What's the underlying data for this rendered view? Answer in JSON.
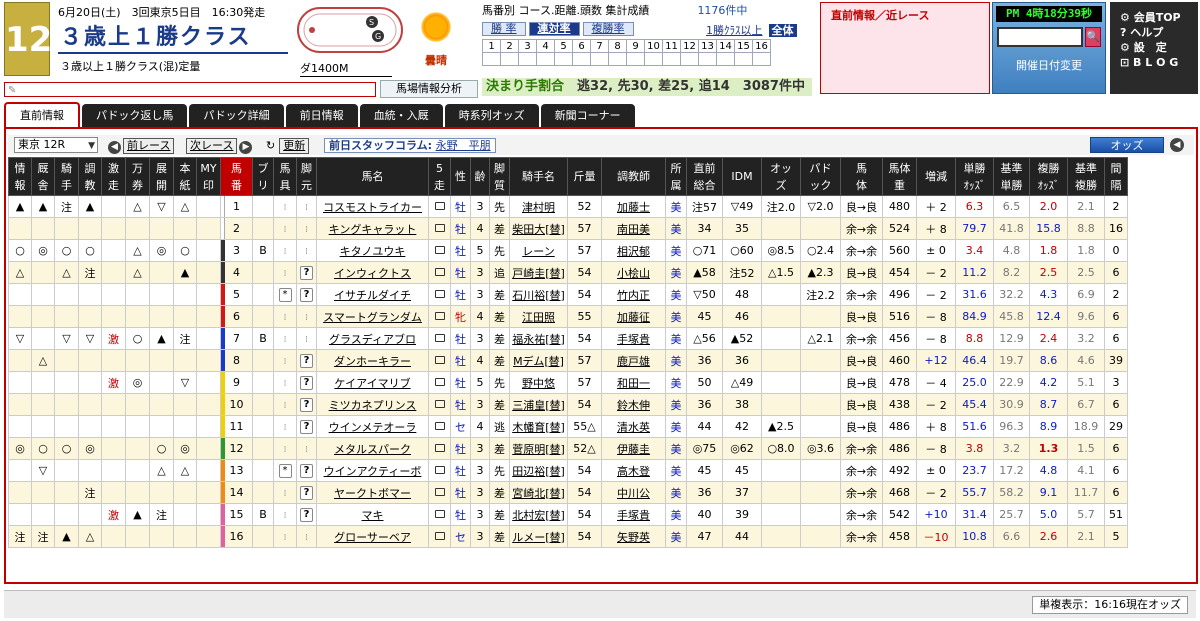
{
  "race": {
    "number": "12",
    "date_line": "6月20日(土)　3回東京5日目　16:30発走",
    "title": "３歳上１勝クラス",
    "subtitle": "３歳以上１勝クラス(混)定量",
    "distance": "ダ1400M",
    "weather": "曇晴"
  },
  "memo_placeholder": "✎",
  "babashi_button": "馬場情報分析",
  "stats": {
    "header": "馬番別 コース.距離.頭数 集計成績",
    "count": "1176件中",
    "tabs": [
      "勝 率",
      "連対率",
      "複勝率"
    ],
    "tabs_selected": "連対率",
    "class_link": "1勝ｸﾗｽ以上",
    "all_label": "全体",
    "grid_row1": [
      "1",
      "2",
      "3",
      "4",
      "5",
      "6",
      "7",
      "8",
      "9",
      "10",
      "11",
      "12",
      "13",
      "14",
      "15",
      "16"
    ],
    "grid_row2": [
      "",
      "",
      "",
      "",
      "",
      "",
      "",
      "",
      "",
      "",
      "",
      "",
      "",
      "",
      "",
      ""
    ],
    "kimari_label": "決まり手割合",
    "kimari_values": "逃32, 先30, 差25, 追14　3087件中"
  },
  "choku": {
    "title": "直前情報／近レース"
  },
  "clock": {
    "time": "PM  4時18分39秒",
    "search_icon": "🔍",
    "date_change": "開催日付変更"
  },
  "menu": [
    "⚙ 会員TOP",
    "? ヘルプ",
    "⚙ 設　定",
    "⊡ B L O G"
  ],
  "tabs": [
    "直前情報",
    "パドック返し馬",
    "パドック詳細",
    "前日情報",
    "血統・入厩",
    "時系列オッズ",
    "新聞コーナー"
  ],
  "bar": {
    "race_select": "東京 12R",
    "prev_race": "前レース",
    "next_race": "次レース",
    "refresh": "更新",
    "column_label": "前日スタッフコラム:",
    "column_author": "永野　平朋",
    "odds_button": "オッズ"
  },
  "columns": [
    "情\n報",
    "厩\n舎",
    "騎\n手",
    "調\n教",
    "激\n走",
    "万\n券",
    "展\n開",
    "本\n紙",
    "MY\n印",
    "馬\n番",
    "ブ\nリ",
    "馬\n具",
    "脚\n元",
    "馬名",
    "5\n走",
    "性",
    "齢",
    "脚\n質",
    "騎手名",
    "斤量",
    "調教師",
    "所\n属",
    "直前\n総合",
    "IDM",
    "オッ\nズ",
    "パド\nック",
    "馬\n体",
    "馬体\n重",
    "増減",
    "単勝\nｵｯｽﾞ",
    "基準\n単勝",
    "複勝\nｵｯｽﾞ",
    "基準\n複勝",
    "間\n隔"
  ],
  "horses": [
    {
      "marks": [
        "▲",
        "▲",
        "注",
        "▲",
        "",
        "△",
        "▽",
        "△",
        ""
      ],
      "num": "1",
      "color": "#ffffff",
      "bl": "",
      "gear": "",
      "leg": "⁞",
      "name": "コスモストライカー",
      "sex": "牡",
      "age": "3",
      "style": "先",
      "jockey": "津村明",
      "kin": "52",
      "trainer": "加藤士",
      "aff": "美",
      "total": "注57",
      "idm": "▽49",
      "odds": "注2.0",
      "pad": "▽2.0",
      "body": "良→良",
      "wt": "480",
      "chg": "＋ 2",
      "tan": "6.3",
      "ktan": "6.5",
      "fuku": "2.0",
      "kfuku": "2.1",
      "int": "2"
    },
    {
      "marks": [
        "",
        "",
        "",
        "",
        "",
        "",
        "",
        "",
        ""
      ],
      "num": "2",
      "color": "#ffffff",
      "bl": "",
      "gear": "",
      "leg": "⁞",
      "name": "キングキャラット",
      "sex": "牡",
      "age": "4",
      "style": "差",
      "jockey": "柴田大[替]",
      "kin": "57",
      "trainer": "南田美",
      "aff": "美",
      "total": "34",
      "idm": "35",
      "odds": "",
      "pad": "",
      "body": "余→余",
      "wt": "524",
      "chg": "＋ 8",
      "tan": "79.7",
      "ktan": "41.8",
      "fuku": "15.8",
      "kfuku": "8.8",
      "int": "16"
    },
    {
      "marks": [
        "○",
        "◎",
        "○",
        "○",
        "",
        "△",
        "◎",
        "○",
        ""
      ],
      "num": "3",
      "color": "#333333",
      "bl": "B",
      "gear": "",
      "leg": "⁞",
      "name": "キタノユウキ",
      "sex": "牡",
      "age": "5",
      "style": "先",
      "jockey": "レーン",
      "kin": "57",
      "trainer": "相沢郁",
      "aff": "美",
      "total": "○71",
      "idm": "○60",
      "odds": "◎8.5",
      "pad": "○2.4",
      "body": "余→余",
      "wt": "560",
      "chg": "± 0",
      "tan": "3.4",
      "ktan": "4.8",
      "fuku": "1.8",
      "kfuku": "1.8",
      "int": "0"
    },
    {
      "marks": [
        "△",
        "",
        "△",
        "注",
        "",
        "△",
        "",
        "▲",
        ""
      ],
      "num": "4",
      "color": "#333333",
      "bl": "",
      "gear": "",
      "leg": "?",
      "name": "インウィクトス",
      "sex": "牡",
      "age": "3",
      "style": "追",
      "jockey": "戸崎圭[替]",
      "kin": "54",
      "trainer": "小桧山",
      "aff": "美",
      "total": "▲58",
      "idm": "注52",
      "odds": "△1.5",
      "pad": "▲2.3",
      "body": "良→良",
      "wt": "454",
      "chg": "－ 2",
      "tan": "11.2",
      "ktan": "8.2",
      "fuku": "2.5",
      "kfuku": "2.5",
      "int": "6"
    },
    {
      "marks": [
        "",
        "",
        "",
        "",
        "",
        "",
        "",
        "",
        ""
      ],
      "num": "5",
      "color": "#d01818",
      "bl": "",
      "gear": "*",
      "leg": "?",
      "name": "イサチルダイチ",
      "sex": "牡",
      "age": "3",
      "style": "差",
      "jockey": "石川裕[替]",
      "kin": "54",
      "trainer": "竹内正",
      "aff": "美",
      "total": "▽50",
      "idm": "48",
      "odds": "",
      "pad": "注2.2",
      "body": "余→余",
      "wt": "496",
      "chg": "－ 2",
      "tan": "31.6",
      "ktan": "32.2",
      "fuku": "4.3",
      "kfuku": "6.9",
      "int": "2"
    },
    {
      "marks": [
        "",
        "",
        "",
        "",
        "",
        "",
        "",
        "",
        ""
      ],
      "num": "6",
      "color": "#d01818",
      "bl": "",
      "gear": "",
      "leg": "⁞",
      "name": "スマートグランダム",
      "sex": "牝",
      "age": "4",
      "style": "差",
      "jockey": "江田照",
      "kin": "55",
      "trainer": "加藤征",
      "aff": "美",
      "total": "45",
      "idm": "46",
      "odds": "",
      "pad": "",
      "body": "良→良",
      "wt": "516",
      "chg": "－ 8",
      "tan": "84.9",
      "ktan": "45.8",
      "fuku": "12.4",
      "kfuku": "9.6",
      "int": "6"
    },
    {
      "marks": [
        "▽",
        "",
        "▽",
        "▽",
        "激",
        "○",
        "▲",
        "注",
        ""
      ],
      "num": "7",
      "color": "#1a3ac8",
      "bl": "B",
      "gear": "",
      "leg": "⁞",
      "name": "グラスディアブロ",
      "sex": "牡",
      "age": "3",
      "style": "差",
      "jockey": "福永祐[替]",
      "kin": "54",
      "trainer": "手塚貴",
      "aff": "美",
      "total": "△56",
      "idm": "▲52",
      "odds": "",
      "pad": "△2.1",
      "body": "余→余",
      "wt": "456",
      "chg": "－ 8",
      "tan": "8.8",
      "ktan": "12.9",
      "fuku": "2.4",
      "kfuku": "3.2",
      "int": "6"
    },
    {
      "marks": [
        "",
        "△",
        "",
        "",
        "",
        "",
        "",
        "",
        ""
      ],
      "num": "8",
      "color": "#1a3ac8",
      "bl": "",
      "gear": "",
      "leg": "?",
      "name": "ダンホーキラー",
      "sex": "牡",
      "age": "4",
      "style": "差",
      "jockey": "Mデム[替]",
      "kin": "57",
      "trainer": "鹿戸雄",
      "aff": "美",
      "total": "36",
      "idm": "36",
      "odds": "",
      "pad": "",
      "body": "良→良",
      "wt": "460",
      "chg": "+12",
      "tan": "46.4",
      "ktan": "19.7",
      "fuku": "8.6",
      "kfuku": "4.6",
      "int": "39"
    },
    {
      "marks": [
        "",
        "",
        "",
        "",
        "激",
        "◎",
        "",
        "▽",
        ""
      ],
      "num": "9",
      "color": "#f0d000",
      "bl": "",
      "gear": "",
      "leg": "?",
      "name": "ケイアイマリブ",
      "sex": "牡",
      "age": "5",
      "style": "先",
      "jockey": "野中悠",
      "kin": "57",
      "trainer": "和田一",
      "aff": "美",
      "total": "50",
      "idm": "△49",
      "odds": "",
      "pad": "",
      "body": "良→良",
      "wt": "478",
      "chg": "－ 4",
      "tan": "25.0",
      "ktan": "22.9",
      "fuku": "4.2",
      "kfuku": "5.1",
      "int": "3"
    },
    {
      "marks": [
        "",
        "",
        "",
        "",
        "",
        "",
        "",
        "",
        ""
      ],
      "num": "10",
      "color": "#f0d000",
      "bl": "",
      "gear": "",
      "leg": "?",
      "name": "ミツカネプリンス",
      "sex": "牡",
      "age": "3",
      "style": "差",
      "jockey": "三浦皇[替]",
      "kin": "54",
      "trainer": "鈴木伸",
      "aff": "美",
      "total": "36",
      "idm": "38",
      "odds": "",
      "pad": "",
      "body": "良→良",
      "wt": "438",
      "chg": "－ 2",
      "tan": "45.4",
      "ktan": "30.9",
      "fuku": "8.7",
      "kfuku": "6.7",
      "int": "6"
    },
    {
      "marks": [
        "",
        "",
        "",
        "",
        "",
        "",
        "",
        "",
        ""
      ],
      "num": "11",
      "color": "#f0d000",
      "bl": "",
      "gear": "",
      "leg": "?",
      "name": "ウインメテオーラ",
      "sex": "セ",
      "age": "4",
      "style": "逃",
      "jockey": "木幡育[替]",
      "kin": "55△",
      "trainer": "清水英",
      "aff": "美",
      "total": "44",
      "idm": "42",
      "odds": "▲2.5",
      "pad": "",
      "body": "良→良",
      "wt": "486",
      "chg": "＋ 8",
      "tan": "51.6",
      "ktan": "96.3",
      "fuku": "8.9",
      "kfuku": "18.9",
      "int": "29"
    },
    {
      "marks": [
        "◎",
        "○",
        "○",
        "◎",
        "",
        "",
        "○",
        "◎",
        ""
      ],
      "num": "12",
      "color": "#2a9a2a",
      "bl": "",
      "gear": "",
      "leg": "⁞",
      "name": "メタルスパーク",
      "sex": "牡",
      "age": "3",
      "style": "差",
      "jockey": "菅原明[替]",
      "kin": "52△",
      "trainer": "伊藤圭",
      "aff": "美",
      "total": "◎75",
      "idm": "◎62",
      "odds": "○8.0",
      "pad": "◎3.6",
      "body": "余→余",
      "wt": "486",
      "chg": "－ 8",
      "tan": "3.8",
      "ktan": "3.2",
      "fuku": "1.3",
      "kfuku": "1.5",
      "int": "6"
    },
    {
      "marks": [
        "",
        "▽",
        "",
        "",
        "",
        "",
        "△",
        "△",
        ""
      ],
      "num": "13",
      "color": "#f08a10",
      "bl": "",
      "gear": "*",
      "leg": "?",
      "name": "ウインアクティーボ",
      "sex": "牡",
      "age": "3",
      "style": "先",
      "jockey": "田辺裕[替]",
      "kin": "54",
      "trainer": "高木登",
      "aff": "美",
      "total": "45",
      "idm": "45",
      "odds": "",
      "pad": "",
      "body": "余→余",
      "wt": "492",
      "chg": "± 0",
      "tan": "23.7",
      "ktan": "17.2",
      "fuku": "4.8",
      "kfuku": "4.1",
      "int": "6"
    },
    {
      "marks": [
        "",
        "",
        "",
        "注",
        "",
        "",
        "",
        "",
        ""
      ],
      "num": "14",
      "color": "#f08a10",
      "bl": "",
      "gear": "",
      "leg": "?",
      "name": "ヤークトボマー",
      "sex": "牡",
      "age": "3",
      "style": "差",
      "jockey": "宮崎北[替]",
      "kin": "54",
      "trainer": "中川公",
      "aff": "美",
      "total": "36",
      "idm": "37",
      "odds": "",
      "pad": "",
      "body": "余→余",
      "wt": "468",
      "chg": "－ 2",
      "tan": "55.7",
      "ktan": "58.2",
      "fuku": "9.1",
      "kfuku": "11.7",
      "int": "6"
    },
    {
      "marks": [
        "",
        "",
        "",
        "",
        "激",
        "▲",
        "注",
        "",
        ""
      ],
      "num": "15",
      "color": "#e060a0",
      "bl": "B",
      "gear": "",
      "leg": "?",
      "name": "マキ",
      "sex": "牡",
      "age": "3",
      "style": "差",
      "jockey": "北村宏[替]",
      "kin": "54",
      "trainer": "手塚貴",
      "aff": "美",
      "total": "40",
      "idm": "39",
      "odds": "",
      "pad": "",
      "body": "余→余",
      "wt": "542",
      "chg": "+10",
      "tan": "31.4",
      "ktan": "25.7",
      "fuku": "5.0",
      "kfuku": "5.7",
      "int": "51"
    },
    {
      "marks": [
        "注",
        "注",
        "▲",
        "△",
        "",
        "",
        "",
        "",
        ""
      ],
      "num": "16",
      "color": "#e060a0",
      "bl": "",
      "gear": "",
      "leg": "⁞",
      "name": "グローサーベア",
      "sex": "セ",
      "age": "3",
      "style": "差",
      "jockey": "ルメー[替]",
      "kin": "54",
      "trainer": "矢野英",
      "aff": "美",
      "total": "47",
      "idm": "44",
      "odds": "",
      "pad": "",
      "body": "余→余",
      "wt": "458",
      "chg": "－10",
      "tan": "10.8",
      "ktan": "6.6",
      "fuku": "2.6",
      "kfuku": "2.1",
      "int": "5"
    }
  ],
  "footer": "単複表示：16:16現在オッズ"
}
